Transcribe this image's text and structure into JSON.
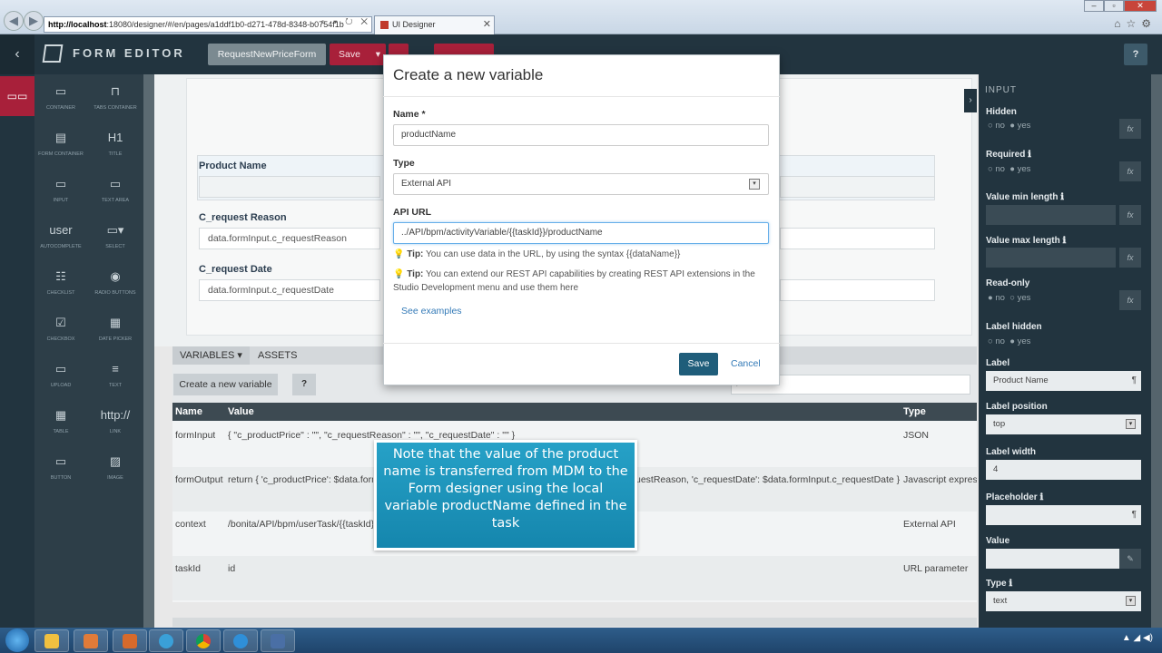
{
  "browser": {
    "address_host": "http://localhost",
    "address_rest": ":18080/designer/#/en/pages/a1ddf1b0-d271-478d-8348-b0754f1b",
    "address_tools": "⌕ ▾ ↻ ✕",
    "tab_title": "UI Designer",
    "tab_close": "✕"
  },
  "app": {
    "title": "FORM EDITOR",
    "form_name": "RequestNewPriceForm",
    "save_label": "Save",
    "save_caret": "▾",
    "help_label": "?",
    "back_icon": "‹"
  },
  "palette": {
    "items": [
      {
        "label": "CONTAINER",
        "icon": "▭"
      },
      {
        "label": "TABS CONTAINER",
        "icon": "⊓"
      },
      {
        "label": "FORM CONTAINER",
        "icon": "▤"
      },
      {
        "label": "TITLE",
        "icon": "H1"
      },
      {
        "label": "INPUT",
        "icon": "▭"
      },
      {
        "label": "TEXT AREA",
        "icon": "▭"
      },
      {
        "label": "AUTOCOMPLETE",
        "icon": "user"
      },
      {
        "label": "SELECT",
        "icon": "▭▾"
      },
      {
        "label": "CHECKLIST",
        "icon": "☷"
      },
      {
        "label": "RADIO BUTTONS",
        "icon": "◉"
      },
      {
        "label": "CHECKBOX",
        "icon": "☑"
      },
      {
        "label": "DATE PICKER",
        "icon": "▦"
      },
      {
        "label": "UPLOAD",
        "icon": "▭"
      },
      {
        "label": "TEXT",
        "icon": "≡"
      },
      {
        "label": "TABLE",
        "icon": "▦"
      },
      {
        "label": "LINK",
        "icon": "http://"
      },
      {
        "label": "BUTTON",
        "icon": "▭"
      },
      {
        "label": "IMAGE",
        "icon": "▨"
      }
    ]
  },
  "canvas": {
    "fields": [
      {
        "label": "Product Name",
        "value": ""
      },
      {
        "label": "C_request Reason",
        "value": "data.formInput.c_requestReason"
      },
      {
        "label": "C_request Date",
        "value": "data.formInput.c_requestDate"
      }
    ]
  },
  "bottom": {
    "tab_variables": "VARIABLES ▾",
    "tab_assets": "ASSETS",
    "create_button": "Create a new variable",
    "help_button": "?",
    "search_icon": "⌕",
    "columns": {
      "name": "Name",
      "value": "Value",
      "type": "Type"
    },
    "rows": [
      {
        "name": "formInput",
        "value": "{ \"c_productPrice\" : \"\", \"c_requestReason\" : \"\", \"c_requestDate\" : \"\" }",
        "type": "JSON"
      },
      {
        "name": "formOutput",
        "value": "return { 'c_productPrice': $data.form",
        "value_tail": "uestReason, 'c_requestDate': $data.formInput.c_requestDate };",
        "type": "Javascript express"
      },
      {
        "name": "context",
        "value": "/bonita/API/bpm/userTask/{{taskId}}",
        "type": "External API"
      },
      {
        "name": "taskId",
        "value": "id",
        "type": "URL parameter"
      }
    ]
  },
  "props": {
    "section": "INPUT",
    "hidden": {
      "label": "Hidden",
      "no": "no",
      "yes": "yes"
    },
    "required": {
      "label": "Required",
      "no": "no",
      "yes": "yes"
    },
    "value_min_length": "Value min length",
    "value_max_length": "Value max length",
    "read_only": {
      "label": "Read-only",
      "no": "no",
      "yes": "yes"
    },
    "label_hidden": {
      "label": "Label hidden",
      "no": "no",
      "yes": "yes"
    },
    "label": {
      "label": "Label",
      "value": "Product Name"
    },
    "label_position": {
      "label": "Label position",
      "value": "top"
    },
    "label_width": {
      "label": "Label width",
      "value": "4"
    },
    "placeholder": "Placeholder",
    "value": "Value",
    "type": {
      "label": "Type",
      "value": "text"
    },
    "fx": "fx",
    "info": "ℹ",
    "pilcrow": "¶",
    "pencil": "✎",
    "select_caret": "▾"
  },
  "modal": {
    "title": "Create a new variable",
    "name_label": "Name *",
    "name_value": "productName",
    "type_label": "Type",
    "type_value": "External API",
    "url_label": "API URL",
    "url_value": "../API/bpm/activityVariable/{{taskId}}/productName",
    "tip1_lead": "Tip:",
    "tip1_text": "You can use data in the URL, by using the syntax {{dataName}}",
    "tip2_lead": "Tip:",
    "tip2_text": "You can extend our REST API capabilities by creating REST API extensions in the Studio Development menu and use them here",
    "examples": "See examples",
    "save": "Save",
    "cancel": "Cancel"
  },
  "annotation": {
    "text": "Note that the value of the product name is transferred from MDM to the Form designer using the local variable productName defined in the task"
  },
  "colors": {
    "accent": "#a8203a",
    "header": "#22343f",
    "primary_button": "#1f5d7a",
    "annotation": "#1e96bf"
  }
}
